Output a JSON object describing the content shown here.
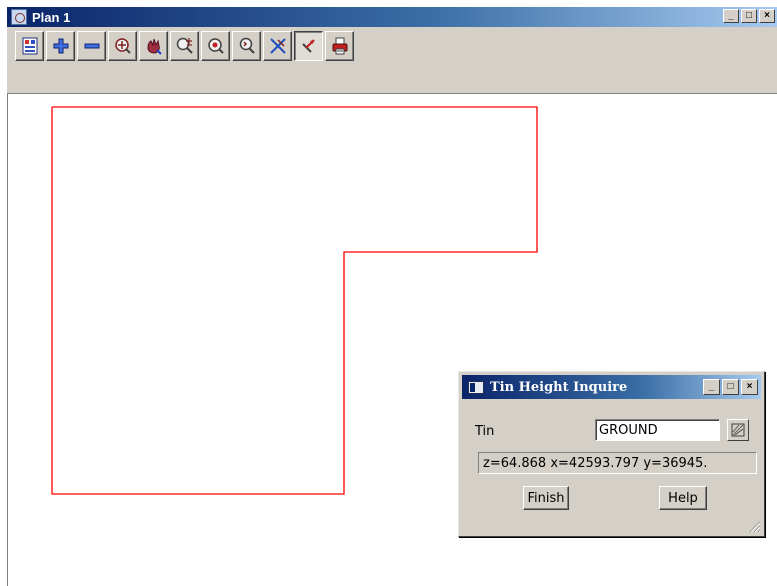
{
  "window": {
    "title": "Plan 1",
    "controls": {
      "minimize": "_",
      "maximize": "□",
      "close": "×"
    }
  },
  "toolbar": {
    "buttons": [
      {
        "name": "plot-icon",
        "pressed": false
      },
      {
        "name": "zoom-in-plus-icon",
        "pressed": false
      },
      {
        "name": "zoom-out-minus-icon",
        "pressed": false
      },
      {
        "name": "zoom-window-icon",
        "pressed": false
      },
      {
        "name": "pan-hand-icon",
        "pressed": false
      },
      {
        "name": "zoom-plus-minus-icon",
        "pressed": false
      },
      {
        "name": "zoom-extents-icon",
        "pressed": false
      },
      {
        "name": "zoom-previous-icon",
        "pressed": false
      },
      {
        "name": "tools-cross-icon",
        "pressed": false
      },
      {
        "name": "pick-arrow-icon",
        "pressed": true
      },
      {
        "name": "print-icon",
        "pressed": false
      }
    ]
  },
  "plan": {
    "line_color": "#ff0000"
  },
  "dialog": {
    "title": "Tin Height Inquire",
    "controls": {
      "minimize": "_",
      "maximize": "□",
      "close": "×"
    },
    "tin_label": "Tin",
    "tin_value": "GROUND",
    "result": "z=64.868 x=42593.797 y=36945.",
    "finish_label": "Finish",
    "help_label": "Help"
  }
}
